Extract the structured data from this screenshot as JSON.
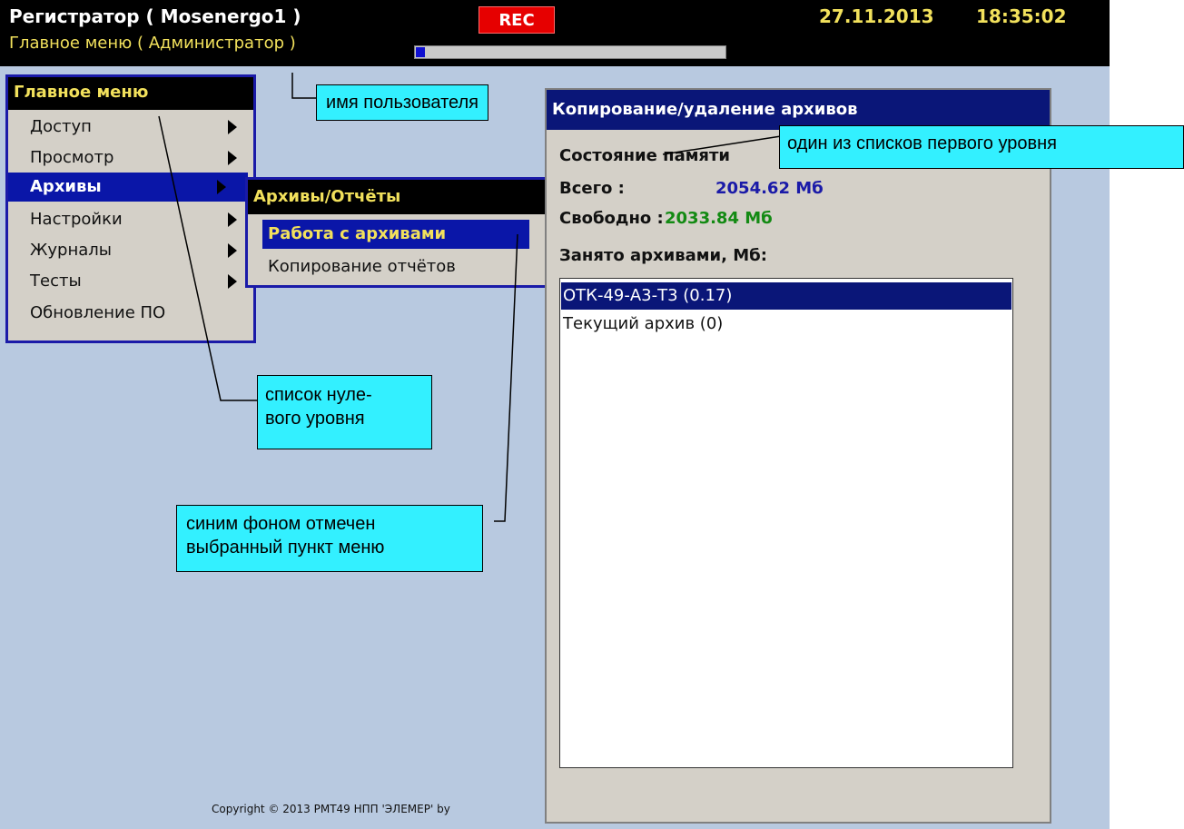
{
  "header": {
    "app_title": "Регистратор ( Mosenergo1 )",
    "menu_path": "Главное меню ( Администратор )",
    "rec_label": "REC",
    "date": "27.11.2013",
    "time": "18:35:02",
    "progress_fraction": 0.03
  },
  "main_menu": {
    "title": "Главное меню",
    "items": [
      {
        "label": "Доступ",
        "has_submenu": true
      },
      {
        "label": "Просмотр",
        "has_submenu": true
      },
      {
        "label": "Архивы",
        "has_submenu": true,
        "selected": true
      },
      {
        "label": "Настройки",
        "has_submenu": true
      },
      {
        "label": "Журналы",
        "has_submenu": true
      },
      {
        "label": "Тесты",
        "has_submenu": true
      },
      {
        "label": "Обновление ПО",
        "has_submenu": false
      }
    ]
  },
  "sub_menu": {
    "title": "Архивы/Отчёты",
    "items": [
      {
        "label": "Работа с архивами",
        "selected": true
      },
      {
        "label": "Копирование отчётов"
      }
    ]
  },
  "archive_dialog": {
    "title": "Копирование/удаление архивов",
    "memory_state_label": "Состояние памяти",
    "total_label": "Всего :",
    "total_value": "2054.62 Мб",
    "free_label": "Свободно :",
    "free_value": "2033.84 Мб",
    "occupied_label": "Занято архивами, Мб:",
    "archives": [
      {
        "label": "ОТК-49-А3-Т3 (0.17)",
        "selected": true
      },
      {
        "label": "Текущий архив (0)"
      }
    ]
  },
  "footer": {
    "copyright": "Copyright © 2013 РМТ49 НПП 'ЭЛЕМЕР' by"
  },
  "annotations": {
    "user_name": "имя пользователя",
    "first_level_list": "один из списков первого уровня",
    "zero_level_list": "список нуле-вого уровня",
    "zero_level_line1": "список нуле-",
    "zero_level_line2": "вого уровня",
    "selected_item_line1": "синим фоном отмечен",
    "selected_item_line2": "выбранный пункт меню"
  },
  "colors": {
    "screen_background": "#b8c9e0",
    "title_bar": "#000000",
    "header_text": "#f2e15c",
    "rec_badge": "#e60000",
    "selection": "#0a16a8",
    "dialog_header": "#0a1678",
    "total_value": "#1a1aa8",
    "free_value": "#138a13",
    "callout": "#33f0ff"
  },
  "icons": {
    "submenu_arrow": "triangle-right-icon"
  }
}
